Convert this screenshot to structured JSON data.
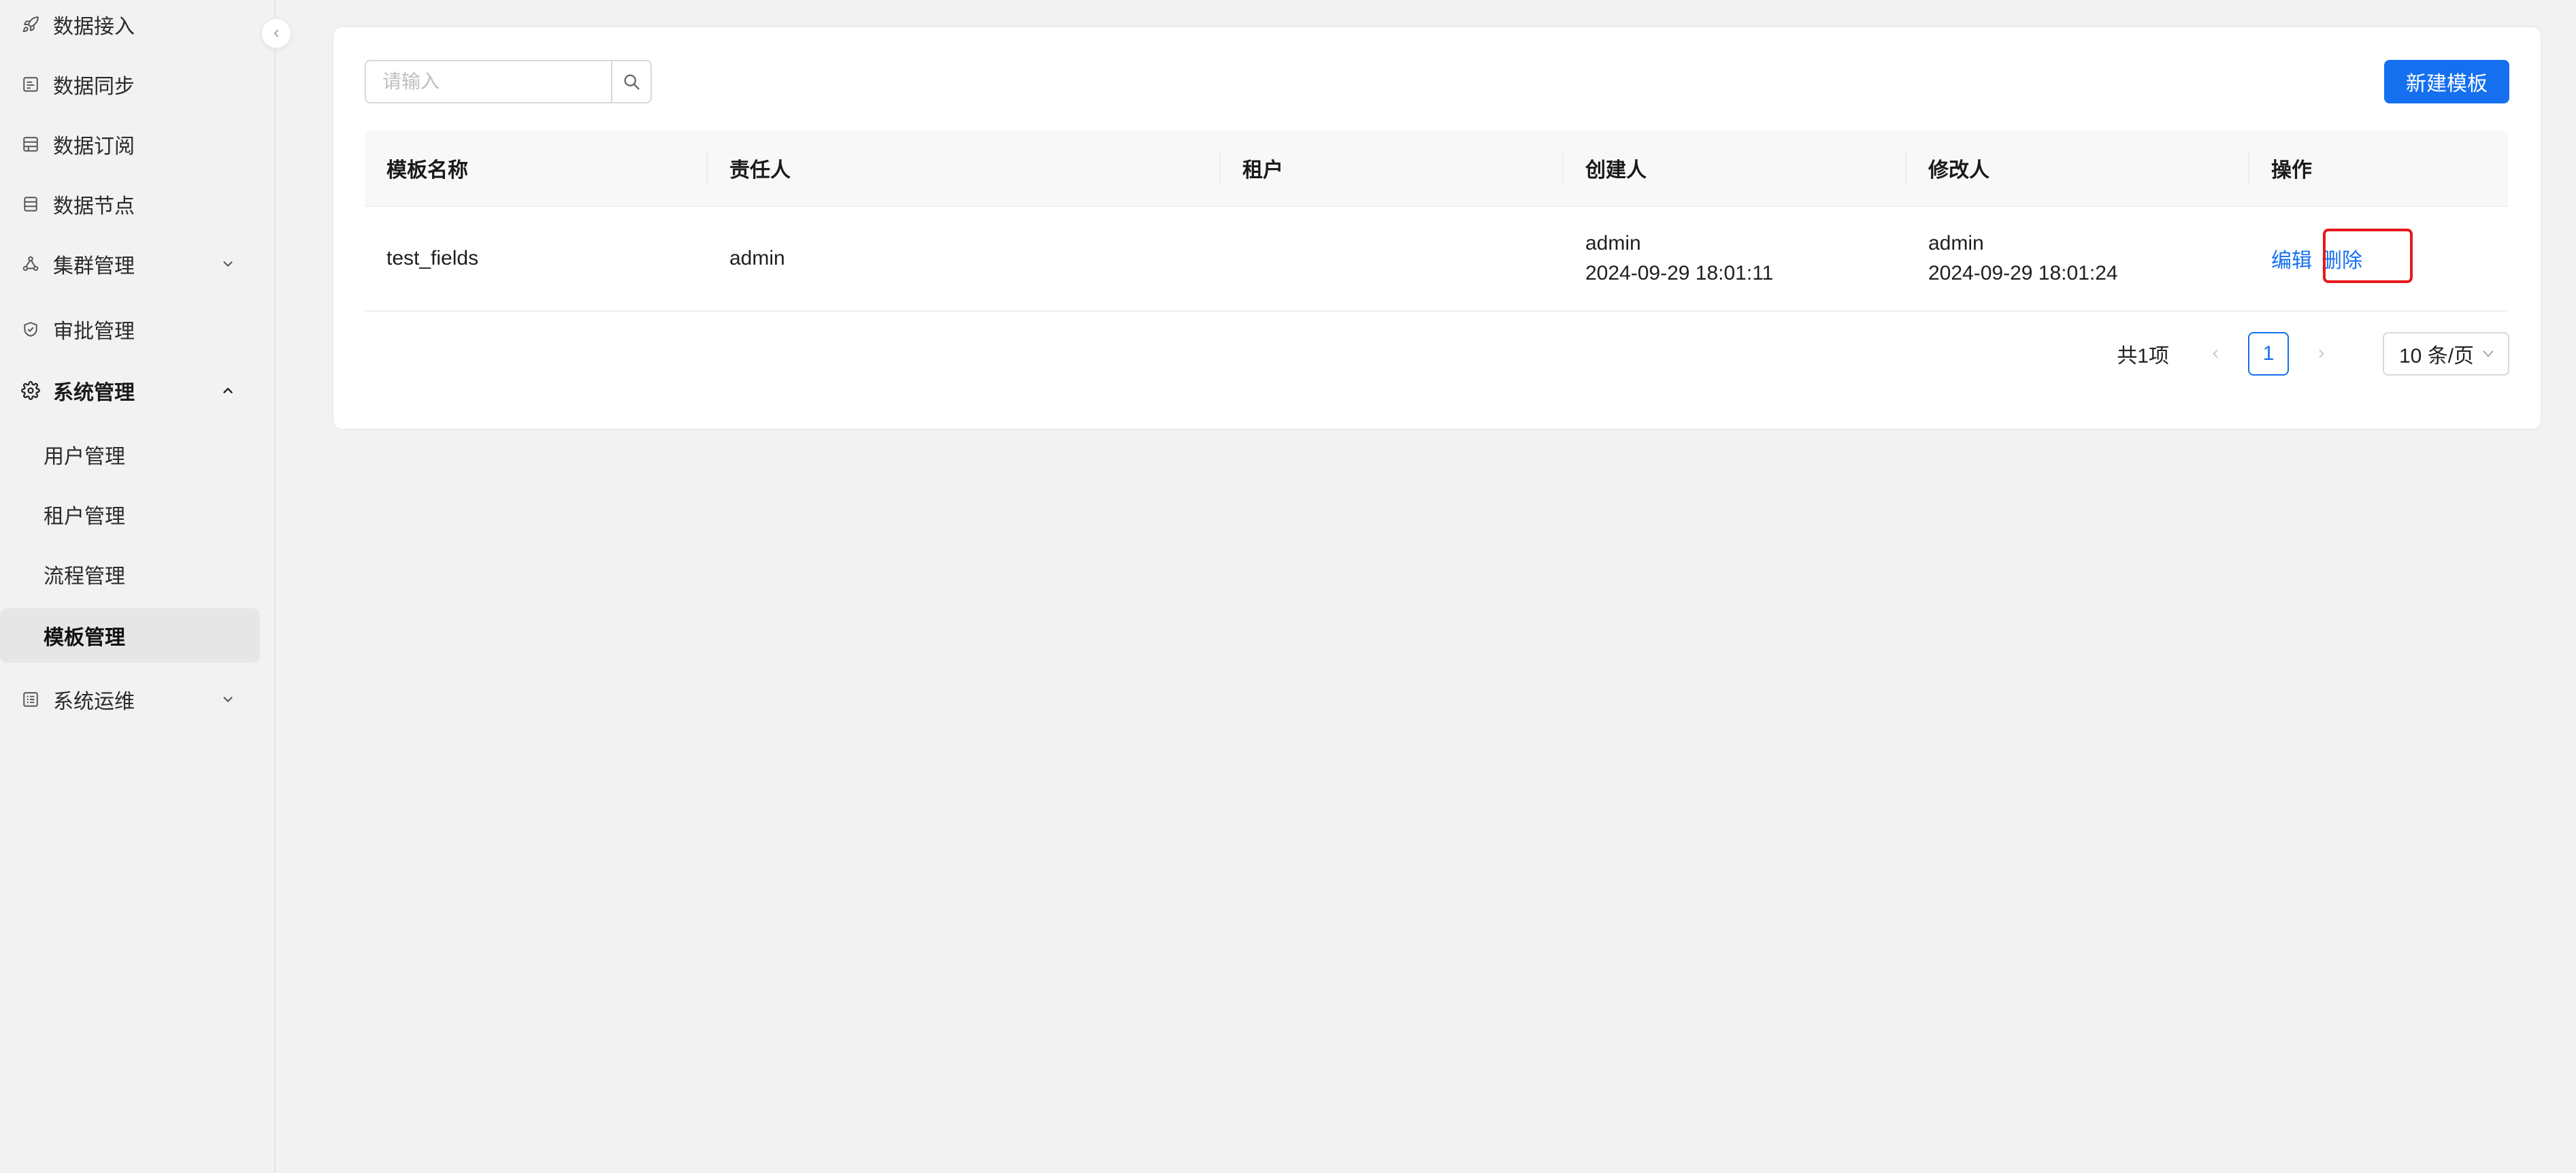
{
  "sidebar": {
    "collapse_icon": "chevron-left-icon",
    "items": [
      {
        "label": "数据接入",
        "icon": "rocket-icon"
      },
      {
        "label": "数据同步",
        "icon": "sync-icon"
      },
      {
        "label": "数据订阅",
        "icon": "subscribe-icon"
      },
      {
        "label": "数据节点",
        "icon": "node-icon"
      },
      {
        "label": "集群管理",
        "icon": "cluster-icon",
        "chevron": "down"
      },
      {
        "label": "审批管理",
        "icon": "shield-check-icon"
      },
      {
        "label": "系统管理",
        "icon": "gear-icon",
        "chevron": "up",
        "expanded": true
      },
      {
        "label": "系统运维",
        "icon": "ops-icon",
        "chevron": "down"
      }
    ],
    "sub_items": [
      {
        "label": "用户管理"
      },
      {
        "label": "租户管理"
      },
      {
        "label": "流程管理"
      },
      {
        "label": "模板管理",
        "active": true
      }
    ]
  },
  "toolbar": {
    "search_placeholder": "请输入",
    "search_icon": "search-icon",
    "new_button_label": "新建模板"
  },
  "table": {
    "columns": [
      "模板名称",
      "责任人",
      "租户",
      "创建人",
      "修改人",
      "操作"
    ],
    "rows": [
      {
        "name": "test_fields",
        "owner": "admin",
        "tenant": "",
        "creator": "admin",
        "created_at": "2024-09-29 18:01:11",
        "modifier": "admin",
        "modified_at": "2024-09-29 18:01:24",
        "actions": {
          "edit": "编辑",
          "delete": "删除"
        }
      }
    ]
  },
  "pagination": {
    "total_label": "共1项",
    "current_page": "1",
    "page_size_label": "10 条/页"
  },
  "colors": {
    "primary": "#1570ef",
    "highlight_border": "#e5191c",
    "page_bg": "#f2f2f2"
  }
}
